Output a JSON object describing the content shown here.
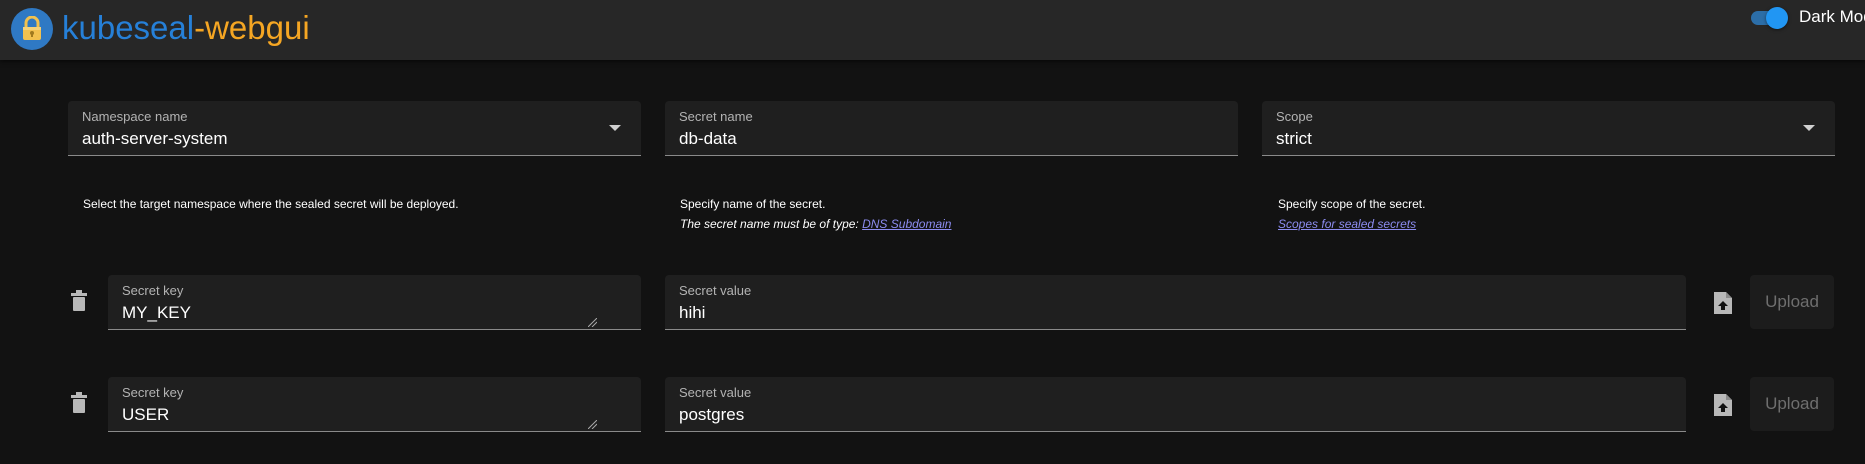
{
  "app": {
    "title_part1": "kubeseal",
    "title_part2": "-webgui",
    "dark_mode_label": "Dark Mode",
    "dark_mode_enabled": true
  },
  "namespace": {
    "label": "Namespace name",
    "value": "auth-server-system",
    "helper": "Select the target namespace where the sealed secret will be deployed."
  },
  "secret_name": {
    "label": "Secret name",
    "value": "db-data",
    "helper_line1": "Specify name of the secret.",
    "helper_line2": "The secret name must be of type: ",
    "helper_link": "DNS Subdomain"
  },
  "scope": {
    "label": "Scope",
    "value": "strict",
    "helper_line1": "Specify scope of the secret.",
    "helper_link": "Scopes for sealed secrets"
  },
  "secrets": [
    {
      "key_label": "Secret key",
      "key": "MY_KEY",
      "value_label": "Secret value",
      "value": "hihi",
      "upload_label": "Upload"
    },
    {
      "key_label": "Secret key",
      "key": "USER",
      "value_label": "Secret value",
      "value": "postgres",
      "upload_label": "Upload"
    }
  ],
  "colors": {
    "accent_blue": "#2680d8",
    "accent_orange": "#f5a623",
    "background": "#121212",
    "appbar": "#272727",
    "link": "#8c8cf0"
  },
  "icons": [
    "lock-icon",
    "chevron-down-icon",
    "trash-icon",
    "file-upload-icon"
  ]
}
